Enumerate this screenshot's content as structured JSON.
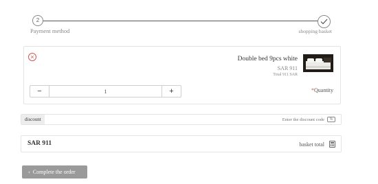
{
  "stepper": {
    "left_step_number": "2",
    "left_step_label": "Payment method",
    "right_step_label": "shopping basket",
    "right_step_icon": "check-icon"
  },
  "product": {
    "name": "Double bed 9pcs white",
    "price": "SAR 911",
    "total": "Total 911 SAR",
    "remove_icon": "close-circle-icon",
    "thumbnail_icon": "product-image"
  },
  "quantity": {
    "minus_label": "−",
    "plus_label": "+",
    "value": "1",
    "label_required_mark": "*",
    "label": "Quantity"
  },
  "discount": {
    "button_label": "discount",
    "placeholder": "Enter the discount code",
    "icon": "tag-icon",
    "icon_glyph": "%"
  },
  "total": {
    "amount": "SAR 911",
    "label": "basket total",
    "icon": "calculator-icon"
  },
  "complete_order": {
    "chevron": "‹",
    "label": "Complete the order"
  },
  "colors": {
    "accent_red": "#d9534f",
    "button_gray": "#9a9a9a",
    "border": "#e4e4e4"
  }
}
